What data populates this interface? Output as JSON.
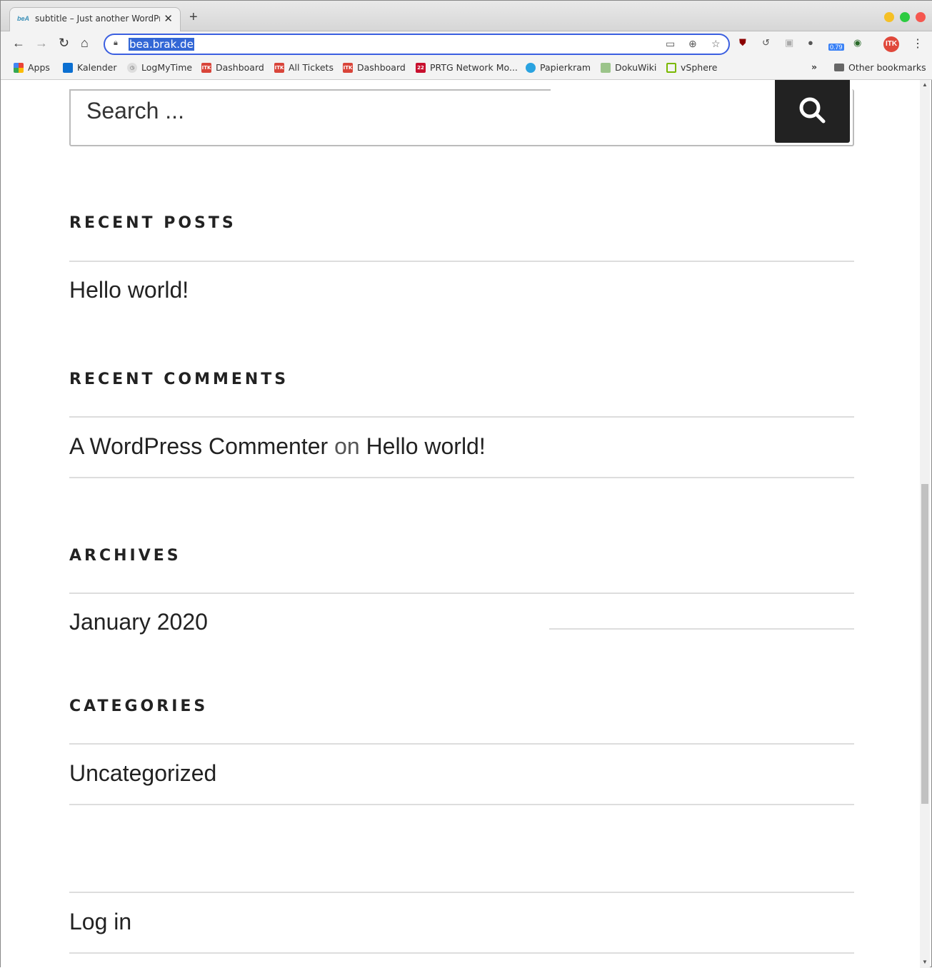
{
  "browser": {
    "tab_title": "subtitle – Just another WordPress",
    "tab_favicon": "beA",
    "url": "bea.brak.de",
    "ext_badge": "0.79",
    "profile": "ITK",
    "bookmarks": [
      {
        "label": "Apps",
        "icon": "apps-grid-icon"
      },
      {
        "label": "Kalender",
        "icon": "calendar-icon"
      },
      {
        "label": "LogMyTime",
        "icon": "clock-icon"
      },
      {
        "label": "Dashboard",
        "icon": "itk-icon"
      },
      {
        "label": "All Tickets",
        "icon": "itk-icon"
      },
      {
        "label": "Dashboard",
        "icon": "itk-icon"
      },
      {
        "label": "PRTG Network Mo...",
        "icon": "prtg-icon"
      },
      {
        "label": "Papierkram",
        "icon": "papierkram-icon"
      },
      {
        "label": "DokuWiki",
        "icon": "dokuwiki-icon"
      },
      {
        "label": "vSphere",
        "icon": "vsphere-icon"
      }
    ],
    "overflow": "»",
    "other_bookmarks": "Other bookmarks"
  },
  "page": {
    "search_placeholder": "Search ...",
    "recent_posts": {
      "heading": "RECENT POSTS",
      "items": [
        "Hello world!"
      ]
    },
    "recent_comments": {
      "heading": "RECENT COMMENTS",
      "author": "A WordPress Commenter",
      "on": "on",
      "post": "Hello world!"
    },
    "archives": {
      "heading": "ARCHIVES",
      "items": [
        "January 2020"
      ]
    },
    "categories": {
      "heading": "CATEGORIES",
      "items": [
        "Uncategorized"
      ]
    },
    "meta": {
      "items": [
        "Log in"
      ]
    }
  }
}
